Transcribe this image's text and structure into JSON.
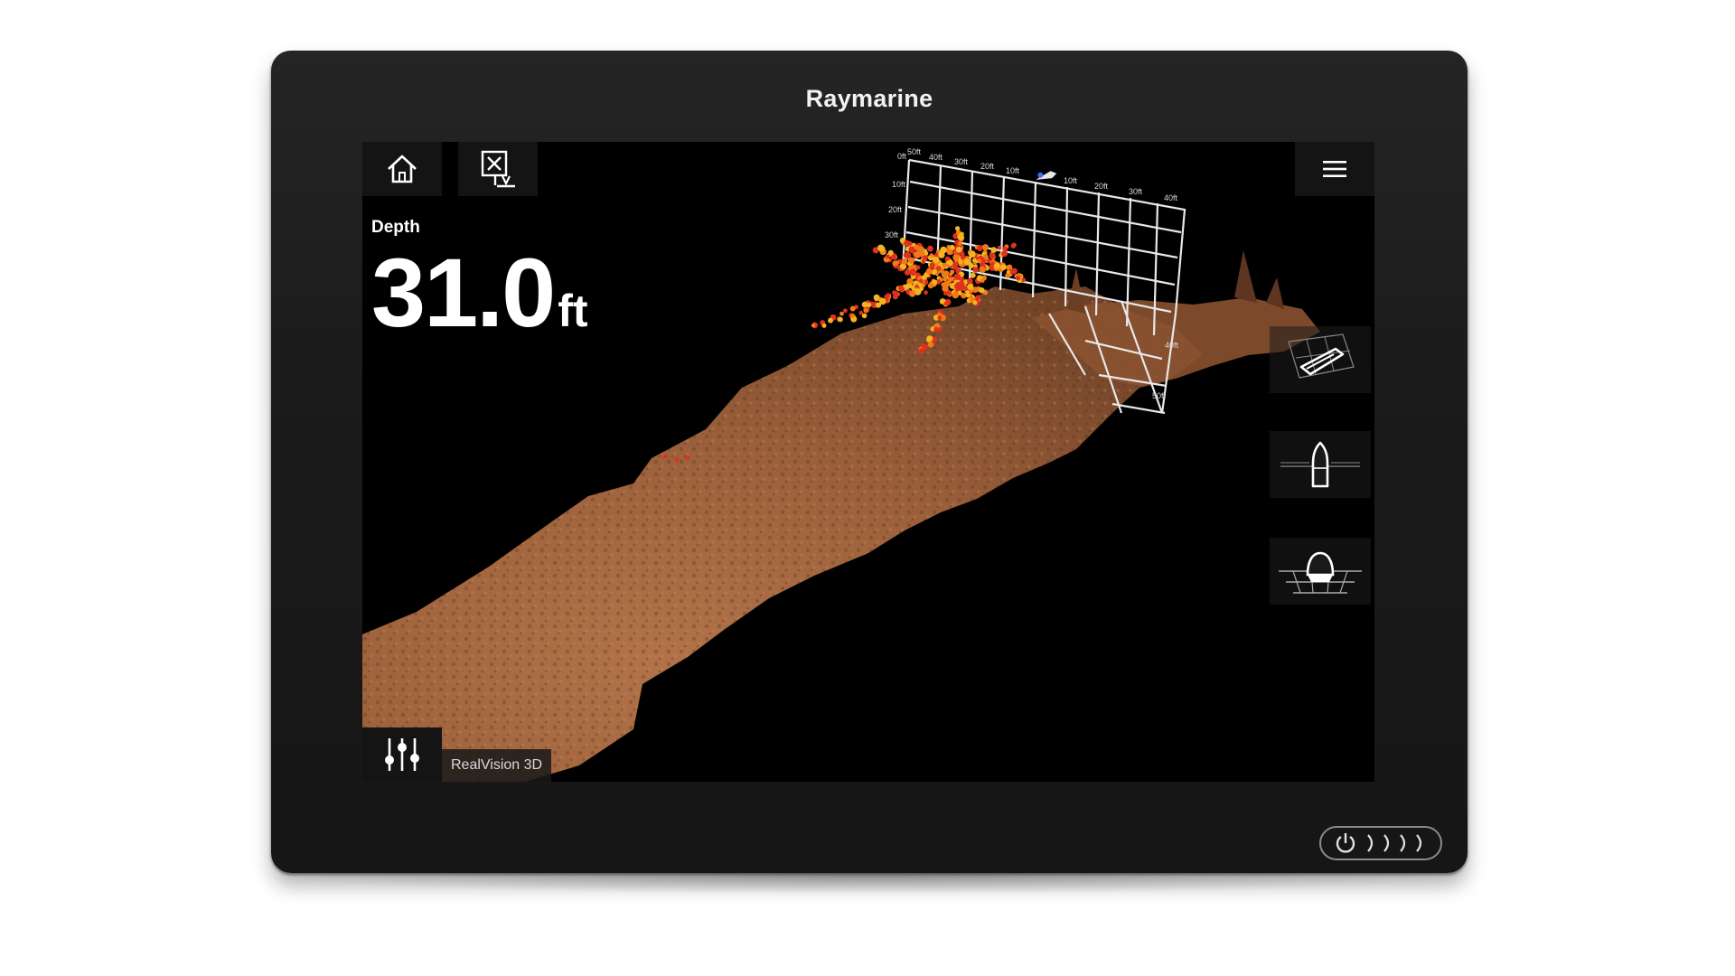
{
  "brand": {
    "name": "Raymarine"
  },
  "readout": {
    "label": "Depth",
    "value": "31.0",
    "unit": "ft"
  },
  "mode": {
    "label": "RealVision 3D"
  },
  "grid": {
    "top_labels": [
      "0ft",
      "50ft",
      "40ft",
      "30ft",
      "20ft",
      "10ft",
      "10ft",
      "20ft",
      "30ft",
      "40ft"
    ],
    "side_labels": [
      "10ft",
      "20ft",
      "30ft",
      "40ft",
      "50ft"
    ]
  },
  "icons": {
    "home": "home-icon",
    "waypoint": "waypoint-icon",
    "menu": "hamburger-menu-icon",
    "settings": "sliders-icon",
    "view_iso": "iso-view-boat-icon",
    "view_top": "top-view-boat-icon",
    "view_front": "front-view-boat-icon",
    "power": "power-icon"
  },
  "colors": {
    "seabed": "#a0663f",
    "target_red": "#e0301e",
    "target_orange": "#f07a18",
    "target_yellow": "#f3b41f",
    "bezel": "#1b1b1b"
  }
}
